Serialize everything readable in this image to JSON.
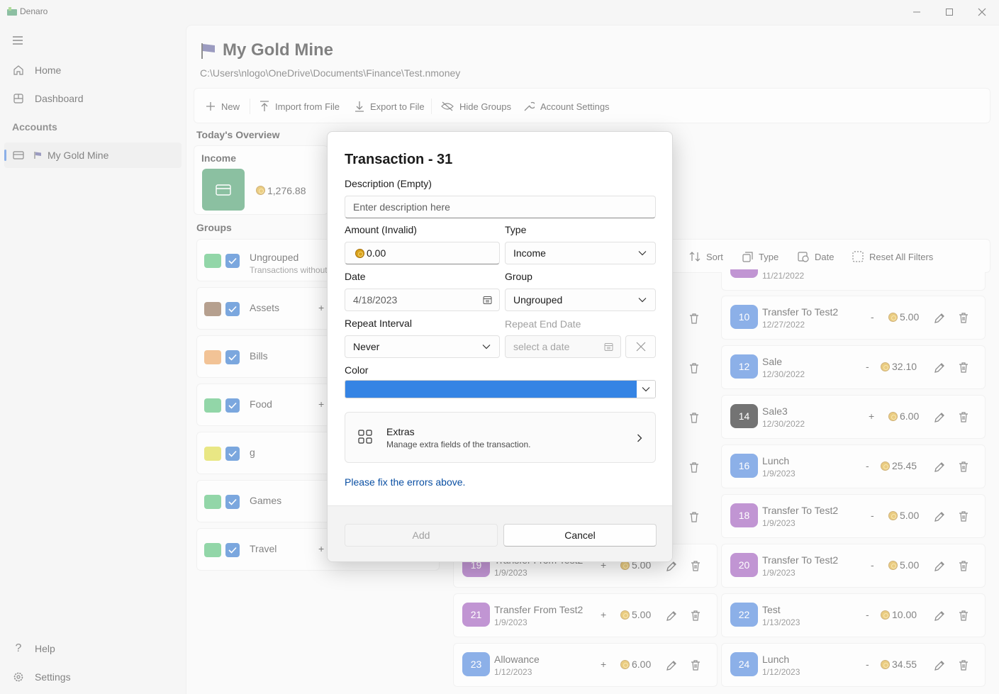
{
  "window": {
    "title": "Denaro"
  },
  "sidebar": {
    "home": "Home",
    "dashboard": "Dashboard",
    "accounts_header": "Accounts",
    "account": "My Gold Mine",
    "help": "Help",
    "settings": "Settings"
  },
  "account": {
    "title": "My Gold Mine",
    "path": "C:\\Users\\nlogo\\OneDrive\\Documents\\Finance\\Test.nmoney"
  },
  "toolbar": {
    "new": "New",
    "import": "Import from File",
    "export": "Export to File",
    "hide_groups": "Hide Groups",
    "account_settings": "Account Settings"
  },
  "overview": {
    "title": "Today's Overview",
    "income_label": "Income",
    "income_amount": "1,276.88"
  },
  "groups": {
    "title": "Groups",
    "items": [
      {
        "name": "Ungrouped",
        "sub": "Transactions without",
        "color": "#3ab562"
      },
      {
        "name": "Assets",
        "color": "#7b5233"
      },
      {
        "name": "Bills",
        "color": "#e89240"
      },
      {
        "name": "Food",
        "color": "#3ab562"
      },
      {
        "name": "g",
        "color": "#d7d420"
      },
      {
        "name": "Games",
        "color": "#3ab562"
      },
      {
        "name": "Travel",
        "color": "#3ab562"
      }
    ]
  },
  "filters": {
    "sort": "Sort",
    "type": "Type",
    "date": "Date",
    "reset": "Reset All Filters",
    "partial_date": "11/21/2022"
  },
  "transactions": {
    "left": [
      {
        "id": "19",
        "name": "Transfer From Test2",
        "date": "1/9/2023",
        "sign": "+",
        "amount": "5.00",
        "color": "#8e3fb0"
      },
      {
        "id": "21",
        "name": "Transfer From Test2",
        "date": "1/9/2023",
        "sign": "+",
        "amount": "5.00",
        "color": "#8e3fb0"
      },
      {
        "id": "23",
        "name": "Allowance",
        "date": "1/12/2023",
        "sign": "+",
        "amount": "6.00",
        "color": "#2f6fd6"
      }
    ],
    "right": [
      {
        "id": "10",
        "name": "Transfer To Test2",
        "date": "12/27/2022",
        "sign": "-",
        "amount": "5.00",
        "color": "#2f6fd6"
      },
      {
        "id": "12",
        "name": "Sale",
        "date": "12/30/2022",
        "sign": "-",
        "amount": "32.10",
        "color": "#2f6fd6"
      },
      {
        "id": "14",
        "name": "Sale3",
        "date": "12/30/2022",
        "sign": "+",
        "amount": "6.00",
        "color": "#000000"
      },
      {
        "id": "16",
        "name": "Lunch",
        "date": "1/9/2023",
        "sign": "-",
        "amount": "25.45",
        "color": "#2f6fd6"
      },
      {
        "id": "18",
        "name": "Transfer To Test2",
        "date": "1/9/2023",
        "sign": "-",
        "amount": "5.00",
        "color": "#8e3fb0"
      },
      {
        "id": "20",
        "name": "Transfer To Test2",
        "date": "1/9/2023",
        "sign": "-",
        "amount": "5.00",
        "color": "#8e3fb0"
      },
      {
        "id": "22",
        "name": "Test",
        "date": "1/13/2023",
        "sign": "-",
        "amount": "10.00",
        "color": "#2f6fd6"
      },
      {
        "id": "24",
        "name": "Lunch",
        "date": "1/12/2023",
        "sign": "-",
        "amount": "34.55",
        "color": "#2f6fd6"
      }
    ]
  },
  "dialog": {
    "title": "Transaction - 31",
    "description_label": "Description (Empty)",
    "description_placeholder": "Enter description here",
    "amount_label": "Amount (Invalid)",
    "amount_value": "0.00",
    "type_label": "Type",
    "type_value": "Income",
    "date_label": "Date",
    "date_value": "4/18/2023",
    "group_label": "Group",
    "group_value": "Ungrouped",
    "repeat_label": "Repeat Interval",
    "repeat_value": "Never",
    "repeat_end_label": "Repeat End Date",
    "repeat_end_placeholder": "select a date",
    "color_label": "Color",
    "color_value": "#3584e4",
    "extras_title": "Extras",
    "extras_sub": "Manage extra fields of the transaction.",
    "error": "Please fix the errors above.",
    "add": "Add",
    "cancel": "Cancel"
  }
}
